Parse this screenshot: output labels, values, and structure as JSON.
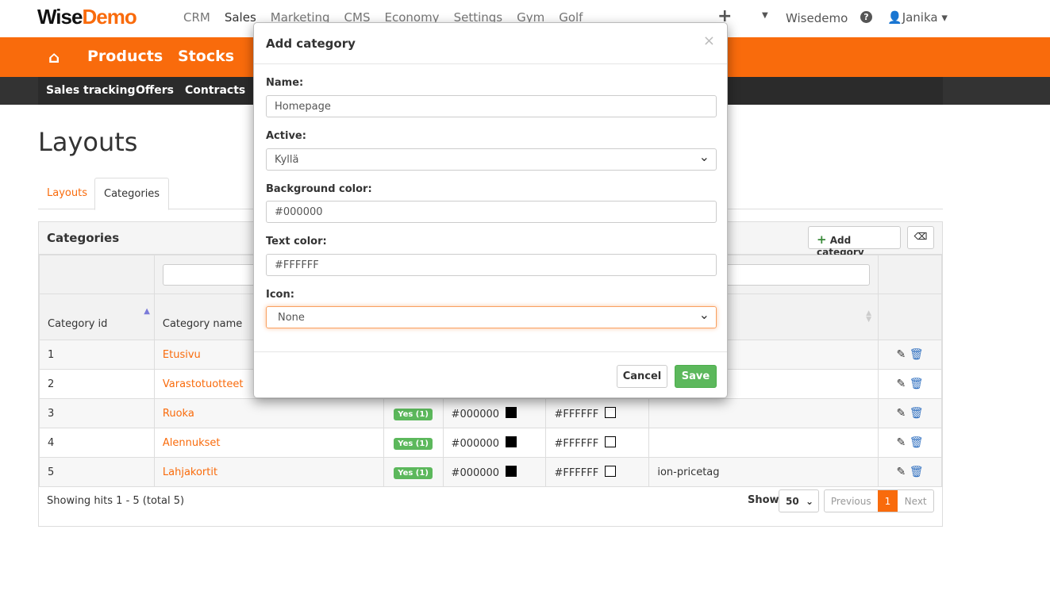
{
  "brand": {
    "part1": "Wise",
    "part2": "Demo"
  },
  "topnav": {
    "items": [
      "CRM",
      "Sales",
      "Marketing",
      "CMS",
      "Economy",
      "Settings",
      "Gym",
      "Golf"
    ],
    "active": "Sales",
    "plus": "+",
    "company": "Wisedemo",
    "help": "?",
    "user": "Janika"
  },
  "mainnav": {
    "items": [
      "Products",
      "Stocks"
    ]
  },
  "subnav": {
    "items": [
      "Sales tracking",
      "Offers",
      "Contracts"
    ]
  },
  "page": {
    "title": "Layouts",
    "tabs": [
      "Layouts",
      "Categories"
    ],
    "active_tab": "Categories"
  },
  "panel": {
    "title": "Categories",
    "add_label": "Add category",
    "columns": [
      "Category id",
      "Category name"
    ],
    "rows": [
      {
        "id": "1",
        "name": "Etusivu",
        "active": "",
        "bg": "",
        "text": "",
        "icon": ""
      },
      {
        "id": "2",
        "name": "Varastotuotteet",
        "active": "",
        "bg": "",
        "text": "",
        "icon": ""
      },
      {
        "id": "3",
        "name": "Ruoka",
        "active": "Yes (1)",
        "bg": "#000000",
        "text": "#FFFFFF",
        "icon": ""
      },
      {
        "id": "4",
        "name": "Alennukset",
        "active": "Yes (1)",
        "bg": "#000000",
        "text": "#FFFFFF",
        "icon": ""
      },
      {
        "id": "5",
        "name": "Lahjakortit",
        "active": "Yes (1)",
        "bg": "#000000",
        "text": "#FFFFFF",
        "icon": "ion-pricetag"
      }
    ],
    "footer": "Showing hits 1 - 5 (total 5)",
    "show_label": "Show",
    "page_size": "50",
    "prev": "Previous",
    "page": "1",
    "next": "Next"
  },
  "modal": {
    "title": "Add category",
    "close": "×",
    "name_label": "Name:",
    "name_value": "Homepage",
    "active_label": "Active:",
    "active_value": "Kyllä",
    "bg_label": "Background color:",
    "bg_value": "#000000",
    "text_label": "Text color:",
    "text_value": "#FFFFFF",
    "icon_label": "Icon:",
    "icon_value": "None",
    "cancel": "Cancel",
    "save": "Save"
  },
  "colors": {
    "accent": "#f96b0c",
    "success": "#5cb85c"
  }
}
